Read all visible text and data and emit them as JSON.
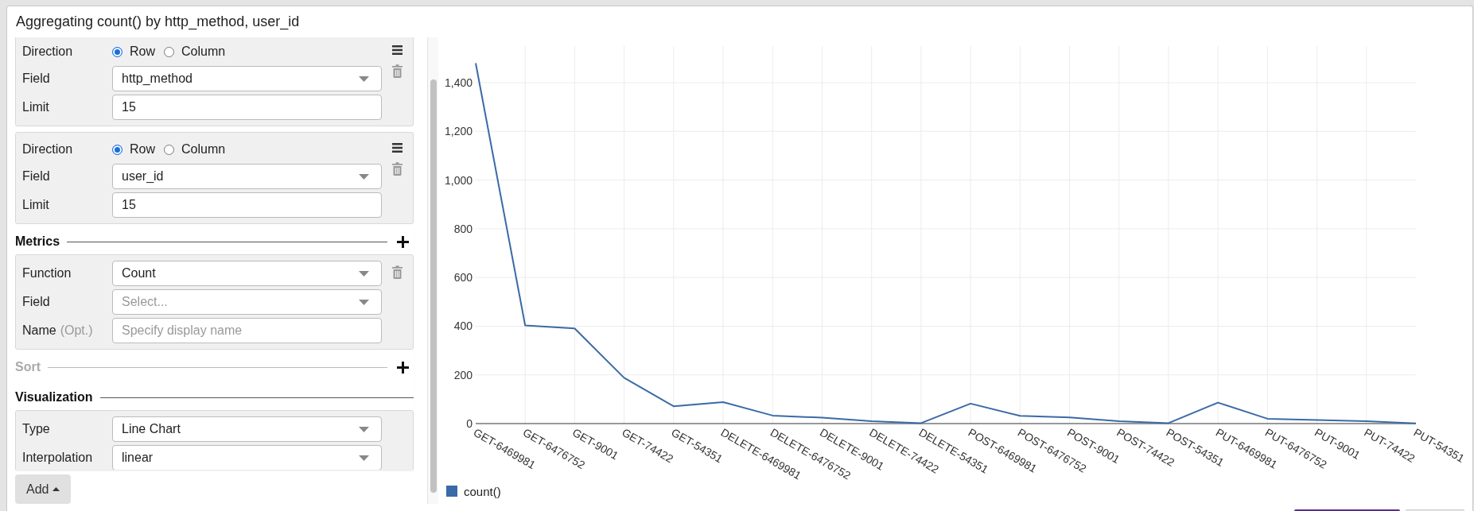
{
  "title": "Aggregating count() by http_method, user_id",
  "config": {
    "items": [
      {
        "kind": "group",
        "reorderable": true,
        "removable": true,
        "rows": [
          {
            "kind": "radio",
            "label": "Direction",
            "options": [
              {
                "label": "Row",
                "selected": true
              },
              {
                "label": "Column",
                "selected": false
              }
            ]
          },
          {
            "kind": "select",
            "label": "Field",
            "value": "http_method"
          },
          {
            "kind": "input",
            "label": "Limit",
            "value": "15"
          }
        ]
      },
      {
        "kind": "group",
        "reorderable": true,
        "removable": true,
        "rows": [
          {
            "kind": "radio",
            "label": "Direction",
            "options": [
              {
                "label": "Row",
                "selected": true
              },
              {
                "label": "Column",
                "selected": false
              }
            ]
          },
          {
            "kind": "select",
            "label": "Field",
            "value": "user_id"
          },
          {
            "kind": "input",
            "label": "Limit",
            "value": "15"
          }
        ]
      },
      {
        "kind": "heading",
        "label": "Metrics",
        "disabled": false,
        "addable": true
      },
      {
        "kind": "group",
        "reorderable": false,
        "removable": true,
        "rows": [
          {
            "kind": "select",
            "label": "Function",
            "value": "Count"
          },
          {
            "kind": "select",
            "label": "Field",
            "placeholder": "Select..."
          },
          {
            "kind": "input",
            "label": "Name",
            "hint": "(Opt.)",
            "placeholder": "Specify display name"
          }
        ]
      },
      {
        "kind": "heading",
        "label": "Sort",
        "disabled": true,
        "addable": true
      },
      {
        "kind": "heading",
        "label": "Visualization",
        "disabled": false,
        "addable": false
      },
      {
        "kind": "group",
        "reorderable": false,
        "removable": false,
        "rows": [
          {
            "kind": "select",
            "label": "Type",
            "value": "Line Chart"
          },
          {
            "kind": "select",
            "label": "Interpolation",
            "value": "linear"
          }
        ]
      }
    ],
    "add_button": {
      "label": "Add"
    }
  },
  "chart": {
    "chart_data": {
      "type": "line",
      "grid": true,
      "categories": [
        "GET-6469981",
        "GET-6476752",
        "GET-9001",
        "GET-74422",
        "GET-54351",
        "DELETE-6469981",
        "DELETE-6476752",
        "DELETE-9001",
        "DELETE-74422",
        "DELETE-54351",
        "POST-6469981",
        "POST-6476752",
        "POST-9001",
        "POST-74422",
        "POST-54351",
        "PUT-6469981",
        "PUT-6476752",
        "PUT-9001",
        "PUT-74422",
        "PUT-54351"
      ],
      "series": [
        {
          "name": "count()",
          "color": "#3a6aa7",
          "values": [
            1480,
            403,
            391,
            188,
            71,
            88,
            33,
            24,
            10,
            2,
            82,
            32,
            25,
            10,
            2,
            86,
            20,
            15,
            10,
            1
          ]
        }
      ],
      "ylim": [
        0,
        1550
      ],
      "yticks": [
        0,
        200,
        400,
        600,
        800,
        {
          "value": 1000,
          "label": "1,000"
        },
        {
          "value": 1200,
          "label": "1,200"
        },
        {
          "value": 1400,
          "label": "1,400"
        }
      ]
    }
  },
  "footer_buttons": [
    {
      "kind": "primary"
    },
    {
      "kind": "secondary"
    }
  ]
}
